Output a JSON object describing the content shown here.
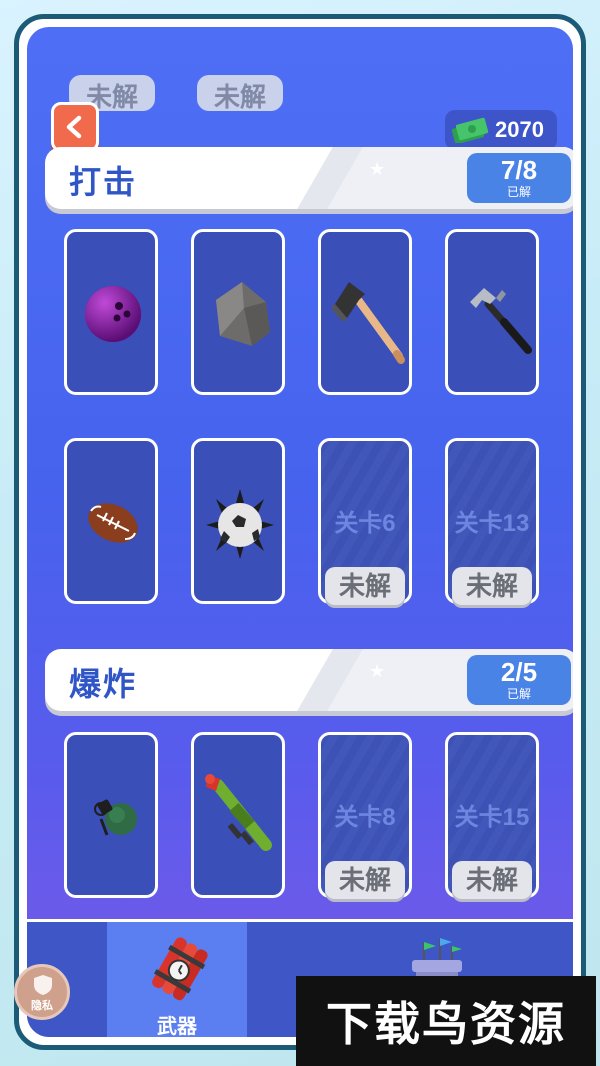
{
  "header": {
    "back_icon": "chevron-left-icon",
    "ghost_tags": [
      "未解",
      "未解"
    ],
    "money": "2070",
    "money_icon": "cash-icon"
  },
  "sections": [
    {
      "title": "打击",
      "count": "7/8",
      "count_sub": "已解",
      "cards": [
        {
          "item": "bowling-ball-icon"
        },
        {
          "item": "rock-icon"
        },
        {
          "item": "axe-icon"
        },
        {
          "item": "hammer-icon"
        },
        {
          "item": "football-icon"
        },
        {
          "item": "spiked-ball-icon"
        },
        {
          "level": "关卡6",
          "status": "未解"
        },
        {
          "level": "关卡13",
          "status": "未解"
        }
      ]
    },
    {
      "title": "爆炸",
      "count": "2/5",
      "count_sub": "已解",
      "cards": [
        {
          "item": "grenade-icon"
        },
        {
          "item": "rocket-launcher-icon"
        },
        {
          "level": "关卡8",
          "status": "未解"
        },
        {
          "level": "关卡15",
          "status": "未解"
        }
      ]
    }
  ],
  "bottom_nav": {
    "weapon_label": "武器",
    "weapon_icon": "dynamite-icon",
    "castle_icon": "castle-icon",
    "privacy_label": "隐私"
  },
  "watermark": "下载鸟资源",
  "colors": {
    "accent": "#4a83e6",
    "back_button": "#f16a4c",
    "section_title": "#2f55c7"
  }
}
